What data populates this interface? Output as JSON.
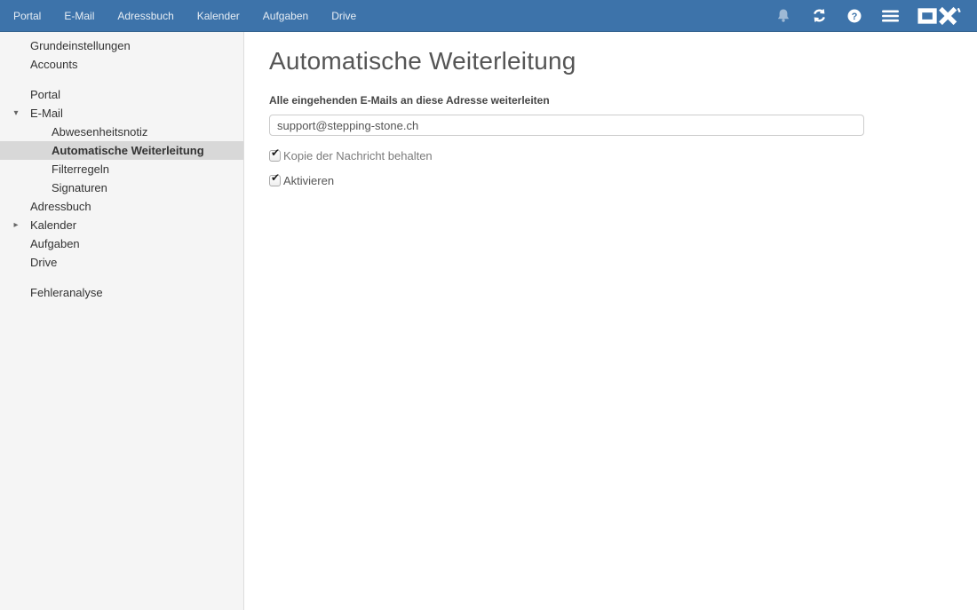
{
  "topbar": {
    "nav": [
      "Portal",
      "E-Mail",
      "Adressbuch",
      "Kalender",
      "Aufgaben",
      "Drive"
    ],
    "logo_text": "OX"
  },
  "icons": {
    "caret_down": "▾",
    "caret_right": "▸",
    "check_glyph": "✔",
    "help_glyph": "?"
  },
  "sidebar": {
    "items": [
      {
        "label": "Grundeinstellungen"
      },
      {
        "label": "Accounts"
      },
      {
        "label": "Portal"
      },
      {
        "label": "E-Mail"
      },
      {
        "label": "Abwesenheitsnotiz"
      },
      {
        "label": "Automatische Weiterleitung"
      },
      {
        "label": "Filterregeln"
      },
      {
        "label": "Signaturen"
      },
      {
        "label": "Adressbuch"
      },
      {
        "label": "Kalender"
      },
      {
        "label": "Aufgaben"
      },
      {
        "label": "Drive"
      },
      {
        "label": "Fehleranalyse"
      }
    ]
  },
  "main": {
    "title": "Automatische Weiterleitung",
    "field_label": "Alle eingehenden E-Mails an diese Adresse weiterleiten",
    "email_value": "support@stepping-stone.ch",
    "checkboxes": [
      {
        "label": "Kopie der Nachricht behalten",
        "checked": true
      },
      {
        "label": "Aktivieren",
        "checked": true
      }
    ]
  },
  "colors": {
    "topbar_blue": "#3d73aa",
    "sidebar_bg": "#f5f5f5",
    "selected_bg": "#d8d8d8",
    "title_gray": "#555555",
    "input_border": "#cccccc"
  }
}
